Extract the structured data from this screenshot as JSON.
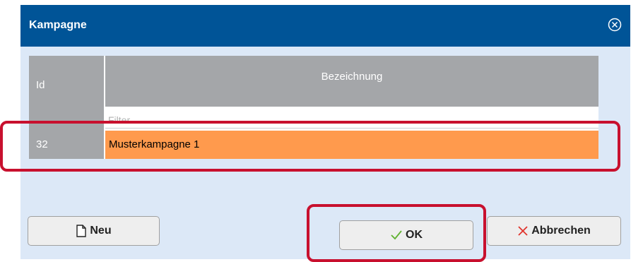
{
  "dialog": {
    "title": "Kampagne",
    "close_icon": "close-circle-icon"
  },
  "grid": {
    "columns": [
      {
        "label": "Id"
      },
      {
        "label": "Bezeichnung"
      }
    ],
    "filter_placeholder": "Filter",
    "rows": [
      {
        "id": "32",
        "name": "Musterkampagne 1",
        "selected": true
      }
    ]
  },
  "buttons": {
    "neu": {
      "label": "Neu",
      "icon": "document-icon"
    },
    "ok": {
      "label": "OK",
      "icon": "checkmark-icon"
    },
    "cancel": {
      "label": "Abbrechen",
      "icon": "x-icon"
    }
  },
  "colors": {
    "titlebar": "#005497",
    "dialog_bg": "#dce8f7",
    "header_bg": "#a4a6a9",
    "selected_row": "#ff9a4d",
    "highlight": "#c8102e",
    "ok_icon": "#5fb130",
    "cancel_icon": "#e0342c"
  }
}
